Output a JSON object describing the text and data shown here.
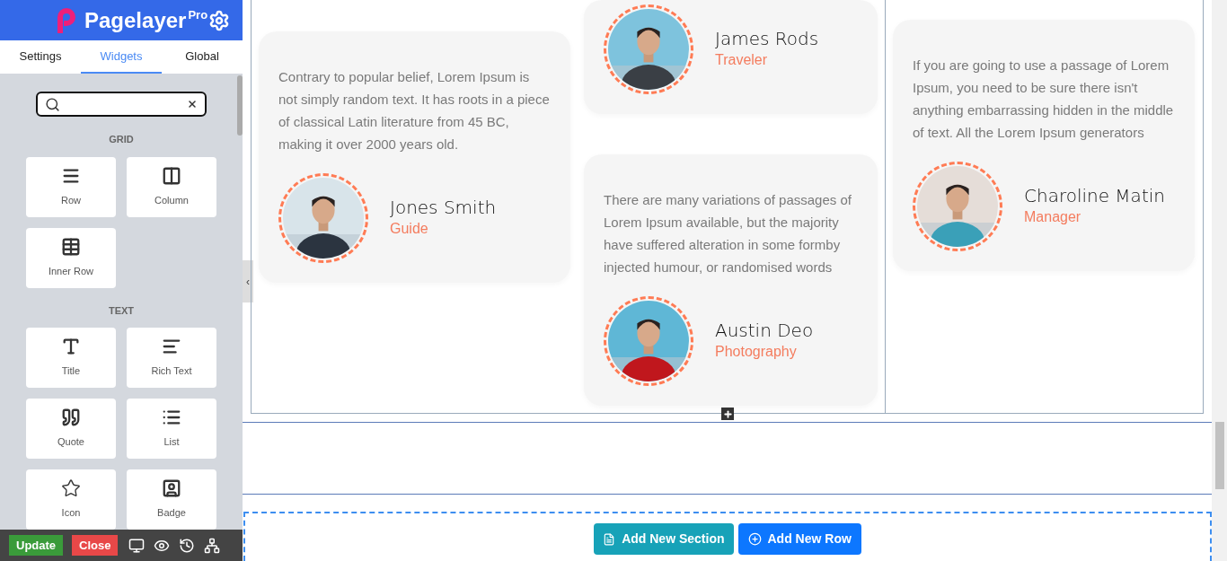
{
  "sidebar": {
    "logo": {
      "name": "Pagelayer",
      "badge": "Pro"
    },
    "tabs": [
      {
        "label": "Settings",
        "selected": false
      },
      {
        "label": "Widgets",
        "selected": true
      },
      {
        "label": "Global",
        "selected": false
      }
    ],
    "groups": [
      {
        "title": "GRID",
        "widgets": [
          {
            "label": "Row",
            "kind": "row"
          },
          {
            "label": "Column",
            "kind": "column"
          },
          {
            "label": "Inner Row",
            "kind": "inner-row"
          }
        ]
      },
      {
        "title": "TEXT",
        "widgets": [
          {
            "label": "Title",
            "kind": "title"
          },
          {
            "label": "Rich Text",
            "kind": "rich-text"
          },
          {
            "label": "Quote",
            "kind": "quote"
          },
          {
            "label": "List",
            "kind": "list"
          },
          {
            "label": "Icon",
            "kind": "icon"
          },
          {
            "label": "Badge",
            "kind": "badge"
          }
        ]
      }
    ],
    "footer": {
      "update": "Update",
      "close": "Close"
    },
    "collapse_handle": "‹"
  },
  "testimonials": [
    [
      {
        "text": "Contrary to popular belief, Lorem Ipsum is not simply random text. It has roots in a piece of classical Latin literature from 45 BC, making it over 2000 years old.",
        "name": "Jones Smith",
        "role": "Guide"
      }
    ],
    [
      {
        "name": "James Rods",
        "role": "Traveler"
      },
      {
        "text": "There are many variations of passages of Lorem Ipsum available, but the majority have suffered alteration in some formby injected humour, or randomised words",
        "name": "Austin Deo",
        "role": "Photography"
      }
    ],
    [
      {
        "text": "If you are going to use a passage of Lorem Ipsum, you need to be sure there isn't anything embarrassing hidden in the middle of text. All the Lorem Ipsum generators",
        "name": "Charoline Matin",
        "role": "Manager"
      }
    ]
  ],
  "actions": {
    "add_section": "Add New Section",
    "add_row": "Add New Row"
  }
}
